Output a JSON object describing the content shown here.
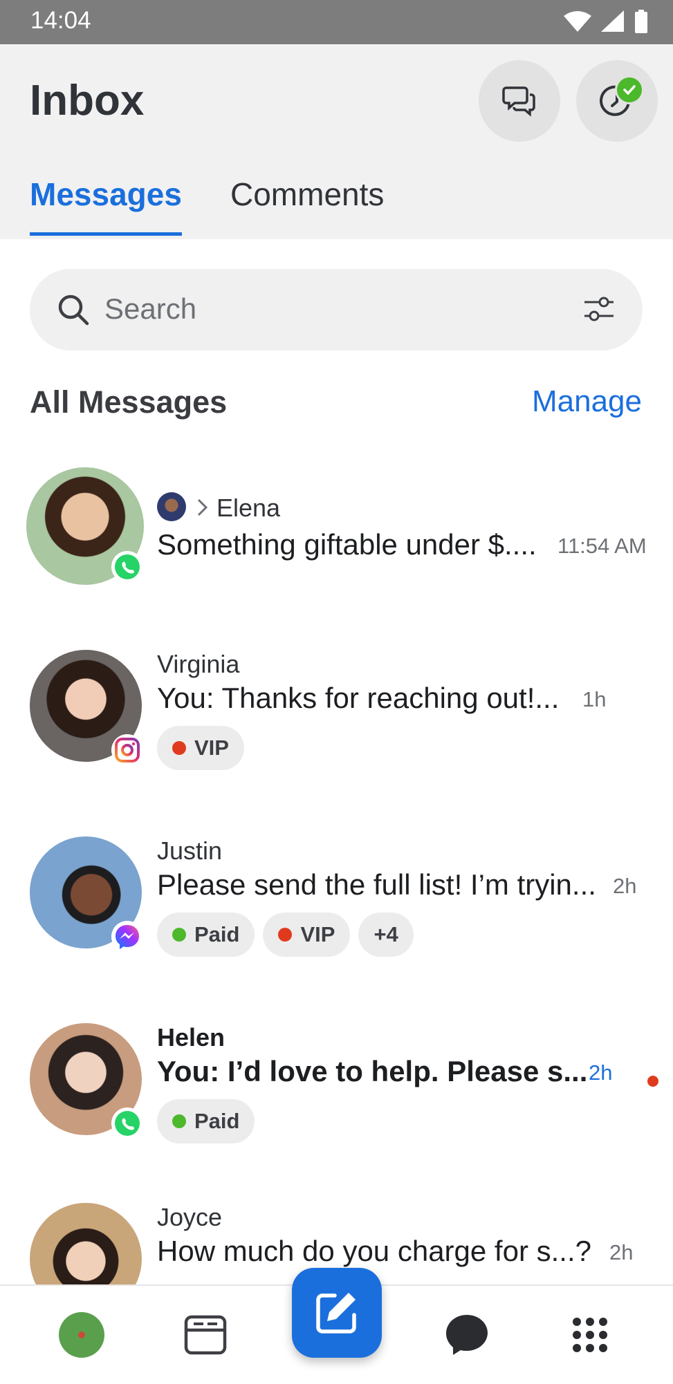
{
  "status_bar": {
    "time": "14:04"
  },
  "header": {
    "title": "Inbox"
  },
  "tabs": [
    {
      "label": "Messages",
      "active": true
    },
    {
      "label": "Comments",
      "active": false
    }
  ],
  "search": {
    "placeholder": "Search"
  },
  "section": {
    "title": "All Messages",
    "manage_label": "Manage"
  },
  "conversations": [
    {
      "name": "Elena",
      "preview": "Something giftable under $....",
      "time": "11:54 AM",
      "platform": "whatsapp-icon",
      "assigned_via": "agent-avatar",
      "unread": false,
      "tags": []
    },
    {
      "name": "Virginia",
      "preview": "You: Thanks for reaching out!...",
      "time": "1h",
      "platform": "instagram-icon",
      "unread": false,
      "tags": [
        {
          "label": "VIP",
          "color": "#e03a1e"
        }
      ]
    },
    {
      "name": "Justin",
      "preview": "Please send the full list! I’m tryin...",
      "time": "2h",
      "platform": "messenger-icon",
      "unread": false,
      "tags": [
        {
          "label": "Paid",
          "color": "#4cb82b"
        },
        {
          "label": "VIP",
          "color": "#e03a1e"
        },
        {
          "label": "+4"
        }
      ]
    },
    {
      "name": "Helen",
      "preview": "You: I’d love to help. Please s...",
      "time": "2h",
      "platform": "whatsapp-icon",
      "unread": true,
      "tags": [
        {
          "label": "Paid",
          "color": "#4cb82b"
        }
      ]
    },
    {
      "name": "Joyce",
      "preview": "How much do you charge for s...?",
      "time": "2h",
      "platform": "",
      "unread": false,
      "tags": []
    }
  ],
  "colors": {
    "accent": "#1b6fdc",
    "whatsapp": "#25d366",
    "unread_dot": "#e03a1e"
  },
  "bottom_nav": [
    {
      "icon": "profile-avatar-icon"
    },
    {
      "icon": "posts-icon"
    },
    {
      "icon": "compose-icon"
    },
    {
      "icon": "chat-bubble-icon"
    },
    {
      "icon": "grid-menu-icon"
    }
  ]
}
